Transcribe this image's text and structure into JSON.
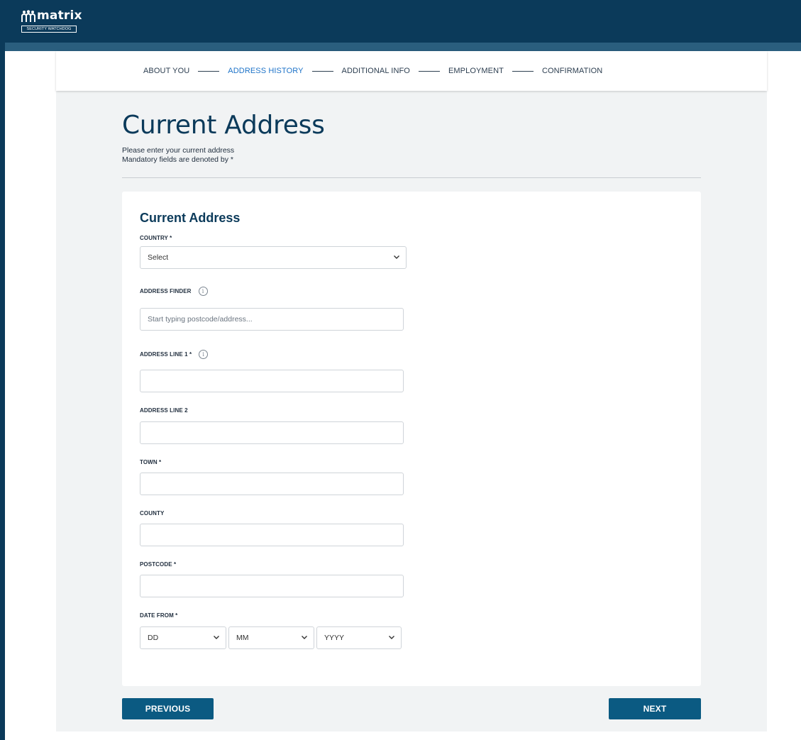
{
  "brand": {
    "name": "matrix",
    "tagline": "SECURITY WATCHDOG",
    "header_color": "#0b3a5a",
    "accent_color": "#1e73c8",
    "button_color": "#0b5a82"
  },
  "stepper": {
    "steps": [
      {
        "label": "ABOUT YOU",
        "active": false
      },
      {
        "label": "ADDRESS HISTORY",
        "active": true
      },
      {
        "label": "ADDITIONAL INFO",
        "active": false
      },
      {
        "label": "EMPLOYMENT",
        "active": false
      },
      {
        "label": "CONFIRMATION",
        "active": false
      }
    ]
  },
  "page": {
    "title": "Current Address",
    "intro_line1": "Please enter your current address",
    "intro_line2": "Mandatory fields are denoted by *"
  },
  "form": {
    "title": "Current Address",
    "country": {
      "label": "COUNTRY *",
      "value": "Select"
    },
    "address_finder": {
      "label": "ADDRESS FINDER",
      "placeholder": "Start typing postcode/address...",
      "value": ""
    },
    "address_line1": {
      "label": "ADDRESS LINE 1 *",
      "value": ""
    },
    "address_line2": {
      "label": "ADDRESS LINE 2",
      "value": ""
    },
    "town": {
      "label": "TOWN *",
      "value": ""
    },
    "county": {
      "label": "COUNTY",
      "value": ""
    },
    "postcode": {
      "label": "POSTCODE *",
      "value": ""
    },
    "date_from": {
      "label": "DATE FROM *",
      "day": "DD",
      "month": "MM",
      "year": "YYYY"
    }
  },
  "buttons": {
    "previous": "PREVIOUS",
    "next": "NEXT"
  },
  "icons": {
    "info": "info-icon",
    "chevron": "chevron-down-icon",
    "logo": "people-logo-icon"
  }
}
